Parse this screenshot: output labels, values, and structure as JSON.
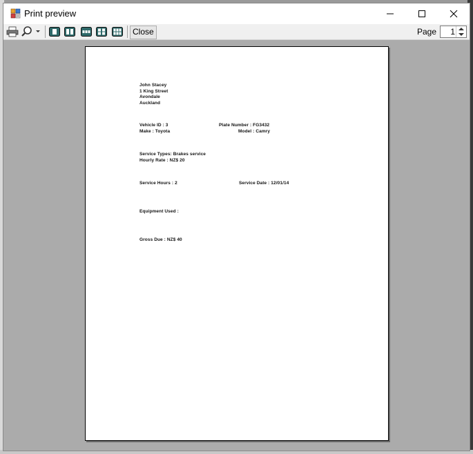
{
  "window": {
    "title": "Print preview",
    "icon": "print-preview-app-icon"
  },
  "toolbar": {
    "tools": [
      "print-icon",
      "zoom-icon",
      "one-page-icon",
      "two-pages-icon",
      "three-pages-icon",
      "four-pages-icon",
      "six-pages-icon"
    ],
    "close_label": "Close",
    "page_label": "Page",
    "page_value": "1"
  },
  "document": {
    "address": [
      "John Stacey",
      "1 King Street",
      "Avondale",
      "Auckland"
    ],
    "vehicle_id": "Vehicle ID  : 3",
    "plate_number": "Plate Number : FG3432",
    "make": "Make        : Toyota",
    "model": "Model       : Camry",
    "service_types": "Service Types: Brakes service",
    "hourly_rate": "Hourly Rate  : NZ$  20",
    "service_hours": "Service Hours  : 2",
    "service_date": "Service Date : 12/01/14",
    "equipment_used": "Equipment Used :",
    "gross_due": "Gross Due : NZ$ 40"
  }
}
